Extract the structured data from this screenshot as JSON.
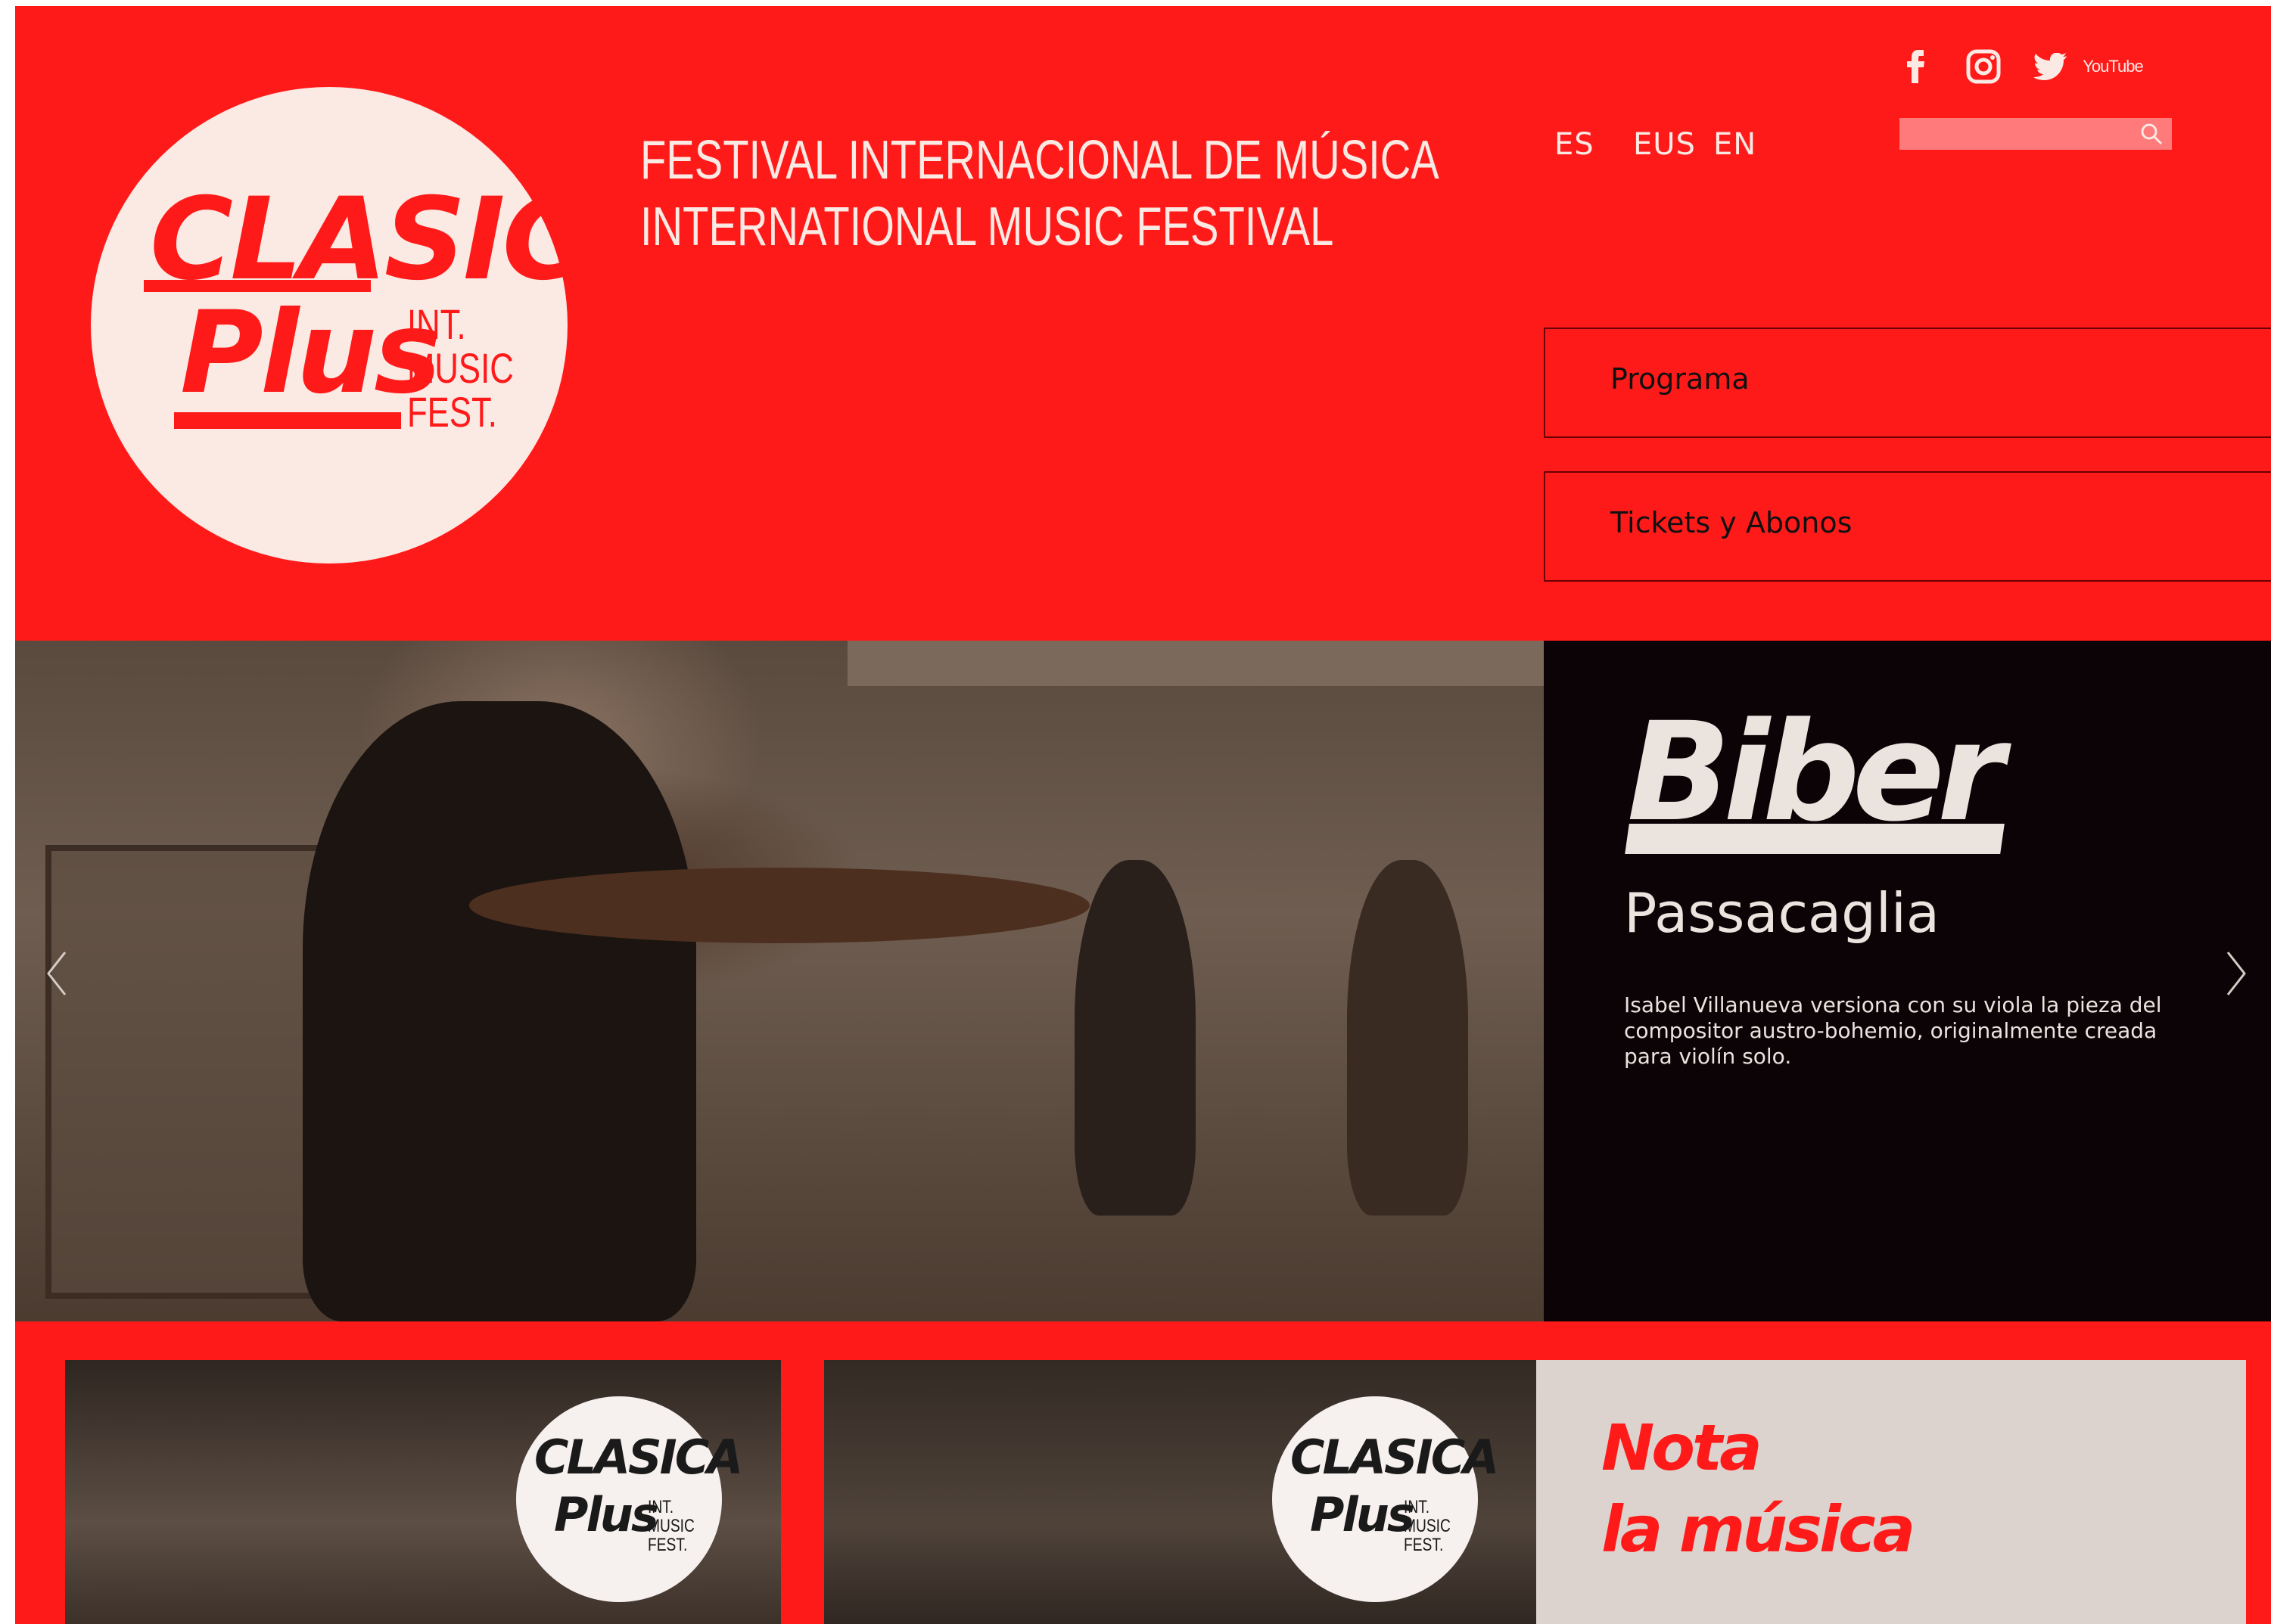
{
  "logo": {
    "line1": "CLASICA",
    "line2": "Plus",
    "sub": [
      "INT.",
      "MUSIC",
      "FEST."
    ]
  },
  "tagline": {
    "line1": "FESTIVAL INTERNACIONAL DE MÚSICA",
    "line2": "INTERNATIONAL MUSIC FESTIVAL"
  },
  "social": {
    "icons": [
      "facebook-icon",
      "instagram-icon",
      "twitter-icon",
      "youtube-icon"
    ],
    "youtube_label": "YouTube"
  },
  "languages": [
    "ES",
    "EUS",
    "EN"
  ],
  "search": {
    "placeholder": ""
  },
  "nav": {
    "items": [
      "Programa",
      "Tickets y Abonos"
    ]
  },
  "hero": {
    "title": "Biber",
    "subtitle": "Passacaglia",
    "description": "Isabel Villanueva versiona con su viola la pieza del compositor austro-bohemio, originalmente creada para violín solo."
  },
  "cards": {
    "badge_line1": "CLASICA",
    "badge_line2": "Plus",
    "badge_sub": "INT.\nMUSIC\nFEST."
  },
  "nota": {
    "line1": "Nota",
    "line2": "la música"
  },
  "colors": {
    "brand_red": "#ff1a1a",
    "cream": "#fbe9e3",
    "hero_dark": "#0c0307",
    "nota_bg": "#ddd3ce"
  }
}
